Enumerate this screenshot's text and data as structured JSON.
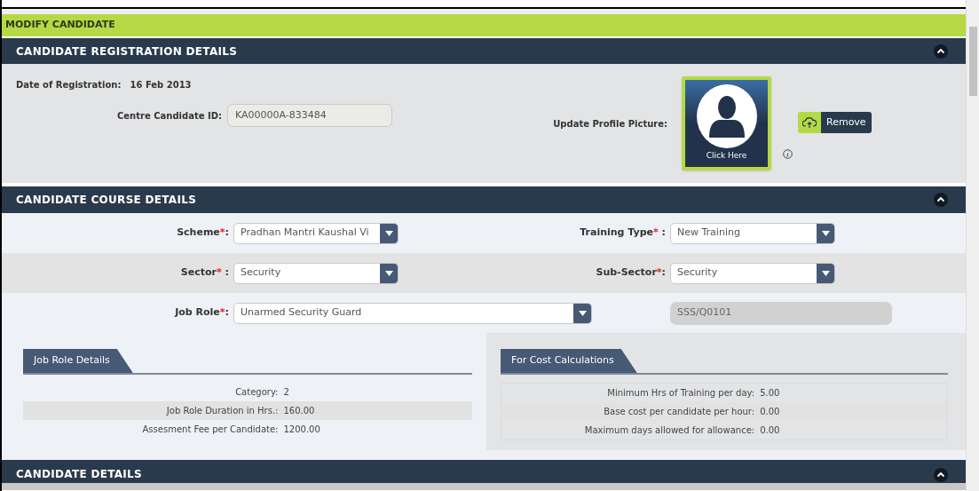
{
  "page_title": "MODIFY CANDIDATE",
  "registration": {
    "title": "CANDIDATE REGISTRATION DETAILS",
    "expanded": true,
    "date_label": "Date of Registration:",
    "date_value": "16 Feb 2013",
    "id_label": "Centre Candidate ID:",
    "id_value": "KA00000A-833484",
    "picture_label": "Update Profile Picture:",
    "picture_caption": "Click Here",
    "remove_button": "Remove"
  },
  "course": {
    "title": "CANDIDATE COURSE DETAILS",
    "expanded": true,
    "required_marker": "*",
    "rows": [
      {
        "left": {
          "label": "Scheme",
          "required": true,
          "suffix": ":",
          "kind": "select",
          "value": "Pradhan Mantri Kaushal Vi"
        },
        "right": {
          "label": "Training Type",
          "required": true,
          "suffix": " :",
          "kind": "select",
          "value": "New Training"
        }
      },
      {
        "left": {
          "label": "Sector",
          "required": true,
          "suffix": " :",
          "kind": "select",
          "value": "Security"
        },
        "right": {
          "label": "Sub-Sector",
          "required": true,
          "suffix": ":",
          "kind": "select",
          "value": "Security"
        }
      },
      {
        "left": {
          "label": "Job Role",
          "required": true,
          "suffix": ":",
          "kind": "wide-select",
          "value": "Unarmed Security Guard"
        },
        "right": {
          "kind": "readonly",
          "value": "SSS/Q0101"
        }
      }
    ]
  },
  "job_role_details": {
    "title": "Job Role Details",
    "rows": [
      {
        "label": "Category:",
        "value": "2"
      },
      {
        "label": "Job Role Duration in Hrs.:",
        "value": "160.00"
      },
      {
        "label": "Assesment Fee per Candidate:",
        "value": "1200.00"
      }
    ]
  },
  "cost_calculations": {
    "title": "For Cost Calculations",
    "rows": [
      {
        "label": "Minimum Hrs of Training per day:",
        "value": "5.00"
      },
      {
        "label": "Base cost per candidate per hour:",
        "value": "0.00"
      },
      {
        "label": "Maximum days allowed for allowance:",
        "value": "0.00"
      }
    ]
  },
  "candidate_details": {
    "title": "CANDIDATE DETAILS",
    "expanded": true
  }
}
